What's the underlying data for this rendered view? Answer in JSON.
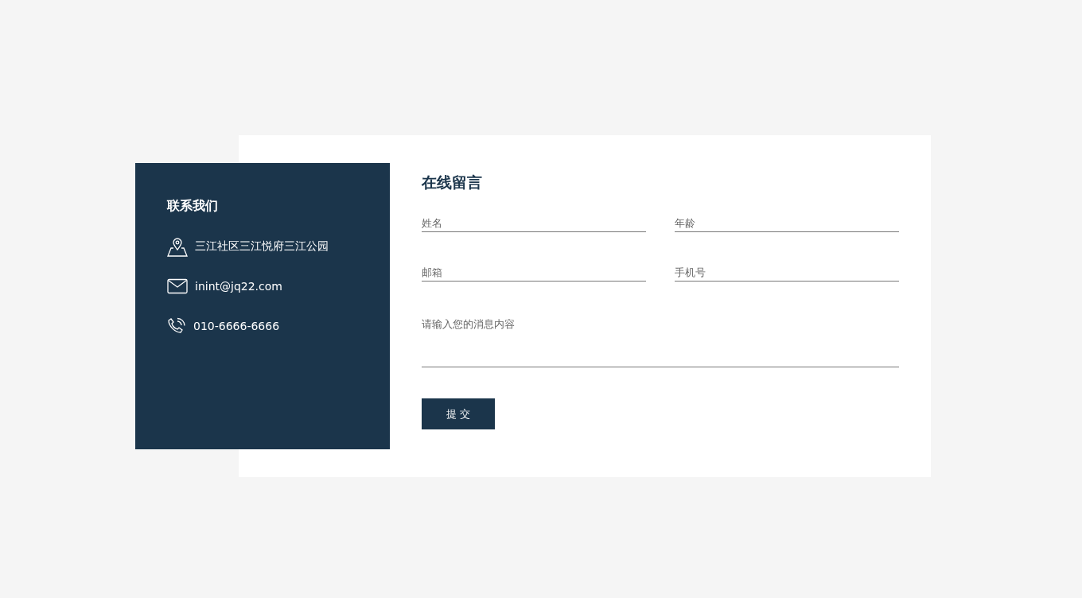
{
  "contact": {
    "title": "联系我们",
    "items": [
      {
        "kind": "location",
        "text": "三江社区三江悦府三江公园"
      },
      {
        "kind": "email",
        "text": "inint@jq22.com"
      },
      {
        "kind": "phone",
        "text": "010-6666-6666"
      }
    ]
  },
  "form": {
    "title": "在线留言",
    "fields": [
      {
        "placeholder": "姓名"
      },
      {
        "placeholder": "年龄"
      },
      {
        "placeholder": "邮箱"
      },
      {
        "placeholder": "手机号"
      }
    ],
    "message": {
      "placeholder": "请输入您的消息内容"
    },
    "submit": "提 交"
  }
}
